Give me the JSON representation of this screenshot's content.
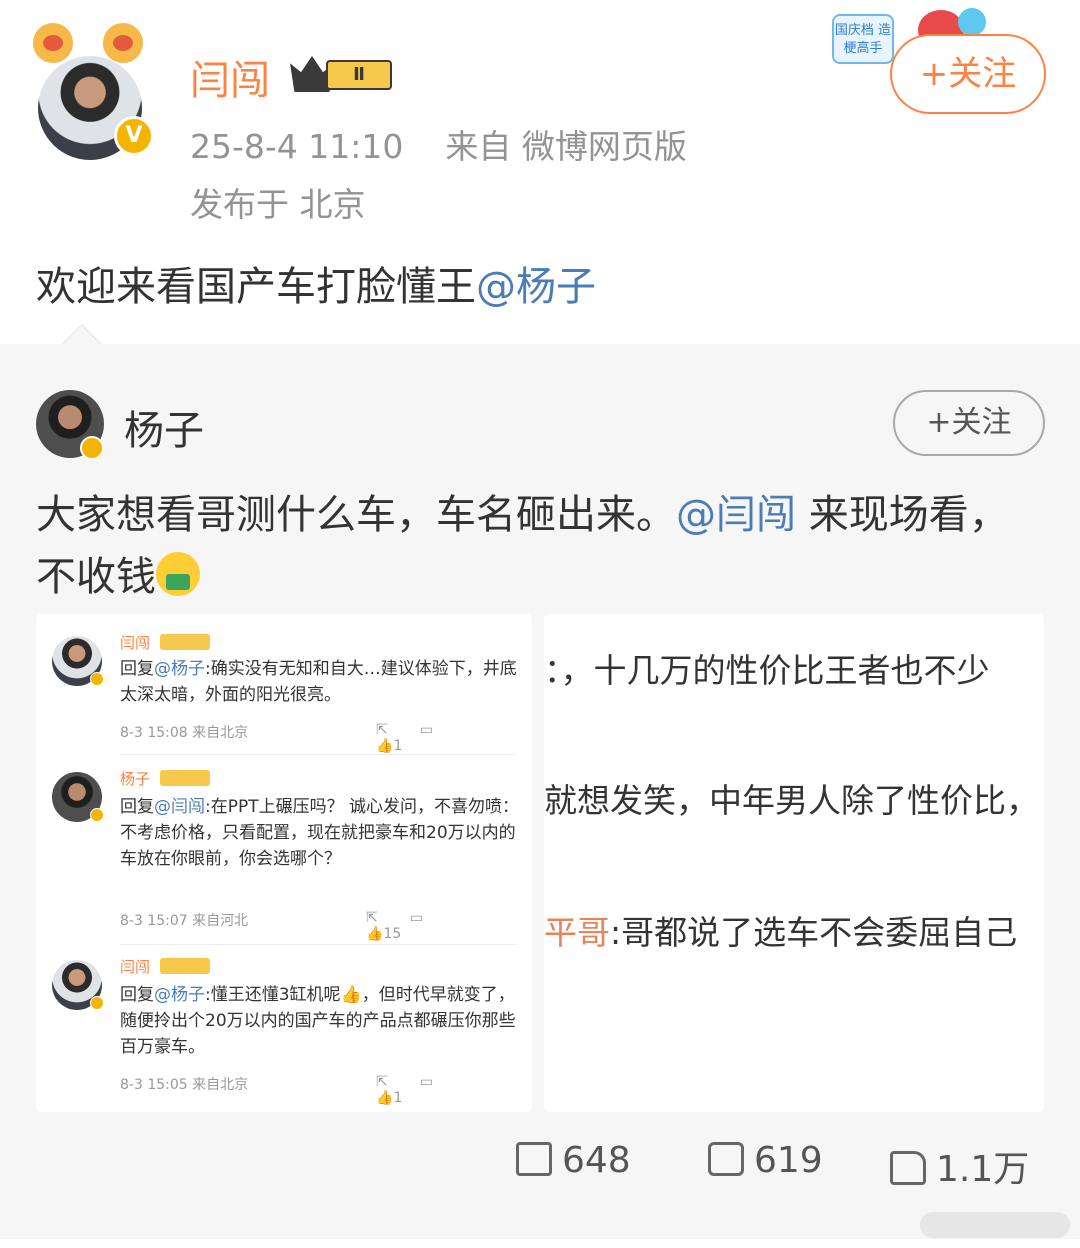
{
  "post": {
    "username": "闫闯",
    "vip_level": "Ⅱ",
    "verified_mark": "V",
    "timestamp": "25-8-4 11:10",
    "source": "来自 微博网页版",
    "location": "发布于 北京",
    "follow_label": "+关注",
    "badge_text": "国庆档 造梗高手",
    "text_main": "欢迎来看国产车打脸懂王",
    "text_mention": "@杨子"
  },
  "repost": {
    "username": "杨子",
    "follow_label": "+关注",
    "text_part1": "大家想看哥测什么车，车名砸出来。",
    "text_mention": "@闫闯",
    "text_part2": " 来现场看，不收钱"
  },
  "comments": [
    {
      "name": "闫闯",
      "reply_prefix": "回复",
      "mention": "@杨子",
      "body": ":确实没有无知和自大…建议体验下，井底太深太暗，外面的阳光很亮。",
      "time": "8-3 15:08",
      "from": "来自北京",
      "likes": "1"
    },
    {
      "name": "杨子",
      "reply_prefix": "回复",
      "mention": "@闫闯",
      "body": ":在PPT上碾压吗？ 诚心发问，不喜勿喷：不考虑价格，只看配置，现在就把豪车和20万以内的车放在你眼前，你会选哪个？",
      "time": "8-3 15:07",
      "from": "来自河北",
      "likes": "15"
    },
    {
      "name": "闫闯",
      "reply_prefix": "回复",
      "mention": "@杨子",
      "body": ":懂王还懂3缸机呢👍，但时代早就变了，随便拎出个20万以内的国产车的产品点都碾压你那些百万豪车。",
      "time": "8-3 15:05",
      "from": "来自北京",
      "likes": "1"
    }
  ],
  "right_image_lines": [
    {
      "text": "：，十几万的性价比王者也不少"
    },
    {
      "text": "就想发笑，中年男人除了性价比，"
    },
    {
      "prefix": "平哥",
      "text": ":哥都说了选车不会委屈自己"
    }
  ],
  "actions": {
    "reposts": "648",
    "comments": "619",
    "likes": "1.1万"
  },
  "colors": {
    "accent_orange": "#ff8140",
    "mention_blue": "#4a7cb5",
    "meta_gray": "#939393"
  }
}
